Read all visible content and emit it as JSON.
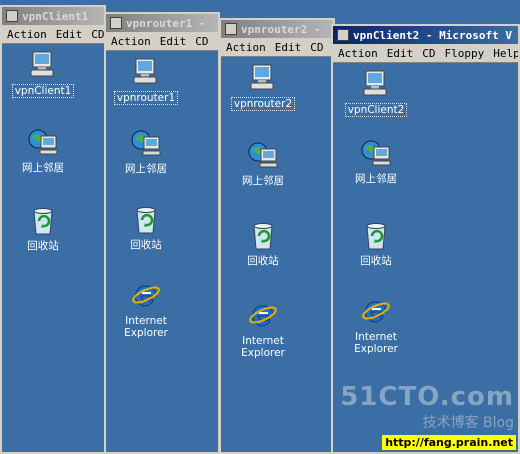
{
  "menu": {
    "action": "Action",
    "edit": "Edit",
    "cd": "CD",
    "floppy": "Floppy",
    "help": "Help"
  },
  "windows": [
    {
      "title": "vpnClient1",
      "computer": "vpnClient1",
      "network": "网上邻居",
      "recycle": "回收站"
    },
    {
      "title": "vpnrouter1 -",
      "computer": "vpnrouter1",
      "network": "网上邻居",
      "recycle": "回收站",
      "ie": "Internet\nExplorer"
    },
    {
      "title": "vpnrouter2 -",
      "computer": "vpnrouter2",
      "network": "网上邻居",
      "recycle": "回收站",
      "ie": "Internet\nExplorer"
    },
    {
      "title": "vpnClient2 - Microsoft V",
      "computer": "vpnClient2",
      "network": "网上邻居",
      "recycle": "回收站",
      "ie": "Internet\nExplorer"
    }
  ],
  "watermark": {
    "main": "51CTO.com",
    "sub": "技术博客 Blog",
    "url": "http://fang.prain.net"
  }
}
